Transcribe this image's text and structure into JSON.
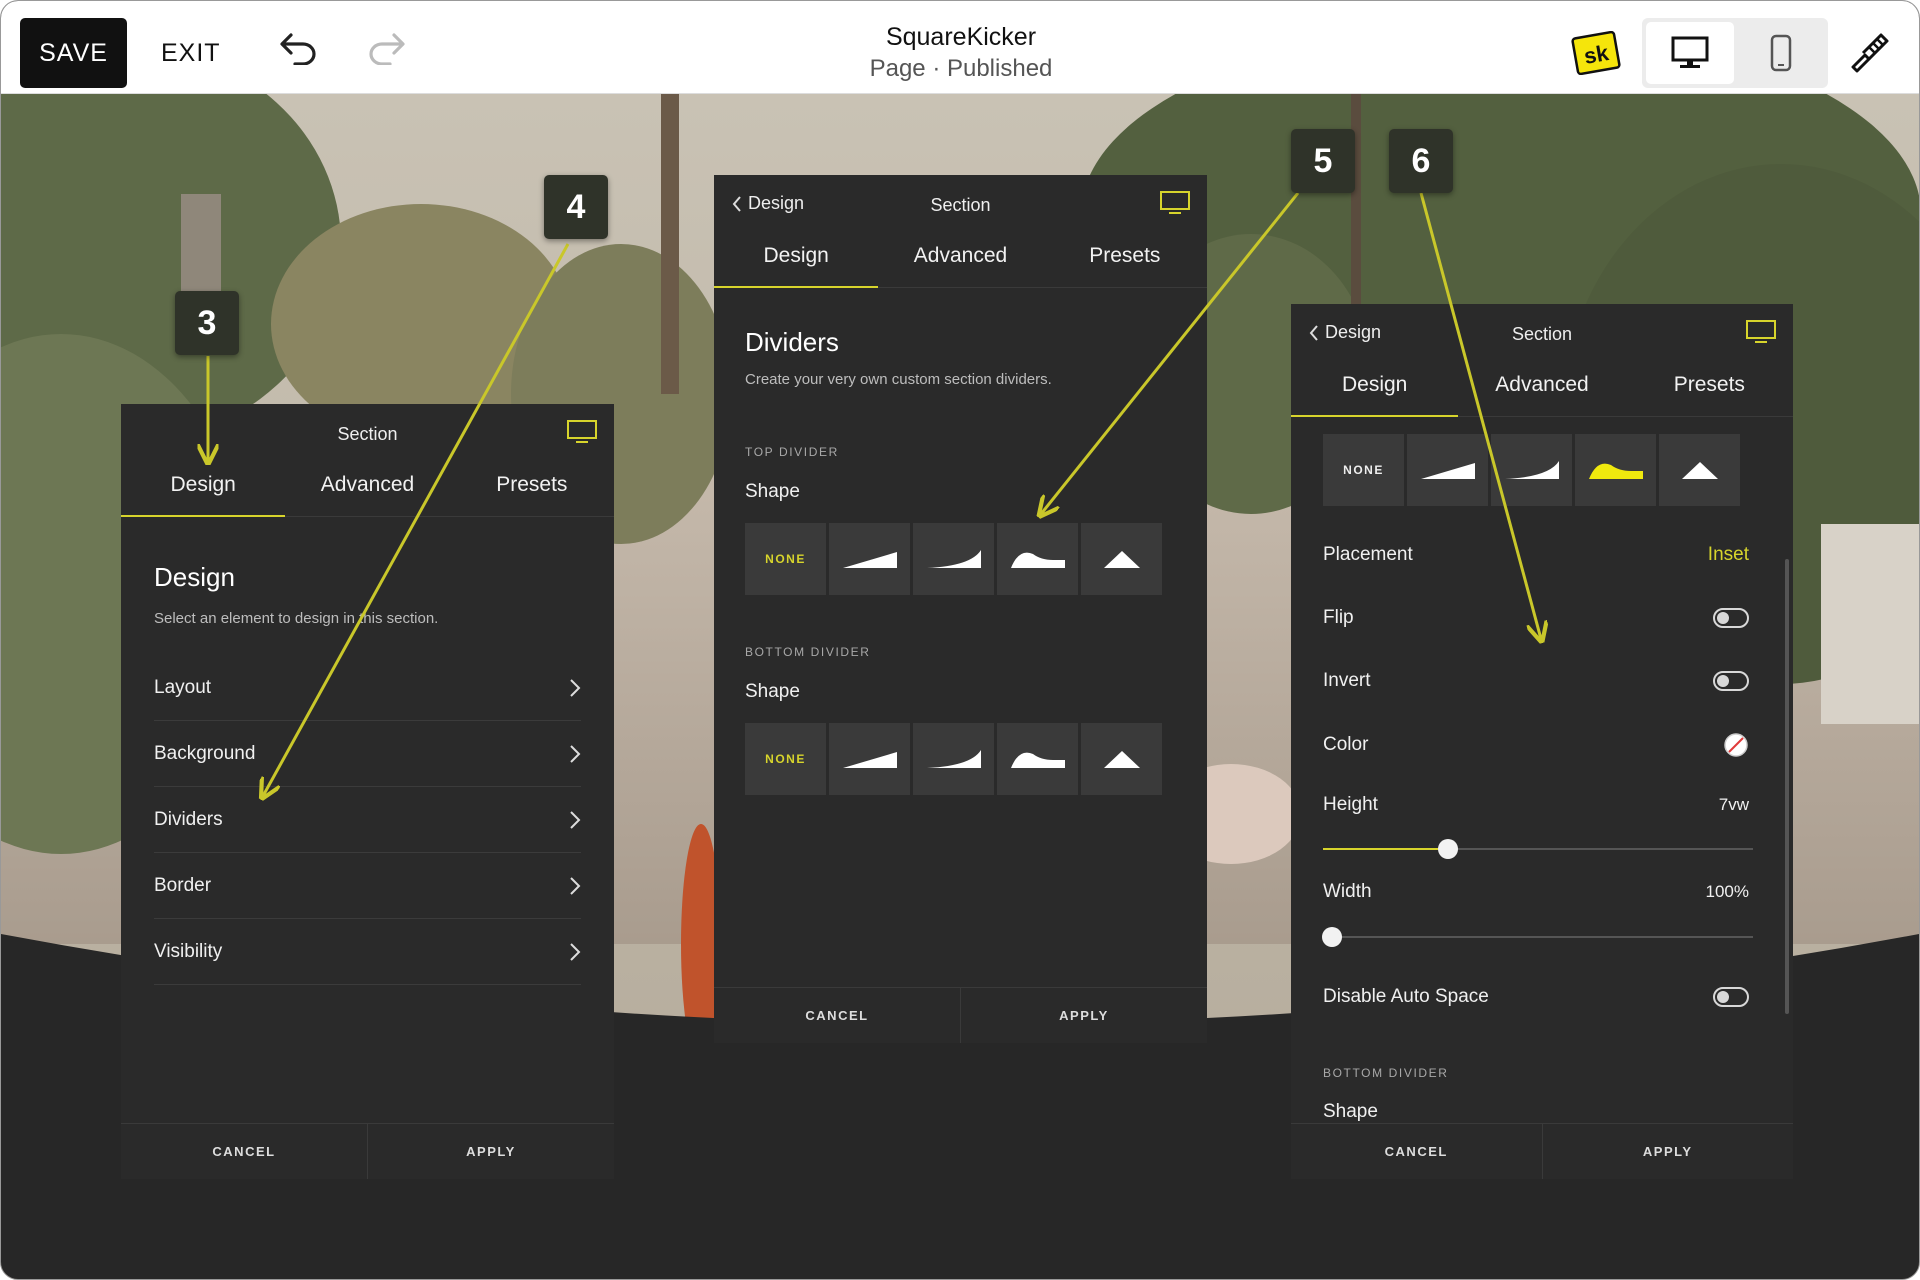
{
  "topbar": {
    "save_label": "SAVE",
    "exit_label": "EXIT",
    "app_title": "SquareKicker",
    "page_status": "Page · Published",
    "logo_text": "sk"
  },
  "colors": {
    "accent": "#d7d42c",
    "panel_bg": "#2a2a2a",
    "tile_bg": "#3a3a3a"
  },
  "callouts": [
    "3",
    "4",
    "5",
    "6"
  ],
  "panel1": {
    "header_section": "Section",
    "tabs": [
      "Design",
      "Advanced",
      "Presets"
    ],
    "active_tab": "Design",
    "title": "Design",
    "subtitle": "Select an element to design in this section.",
    "items": [
      "Layout",
      "Background",
      "Dividers",
      "Border",
      "Visibility"
    ],
    "footer": {
      "cancel": "CANCEL",
      "apply": "APPLY"
    }
  },
  "panel2": {
    "back_label": "Design",
    "header_section": "Section",
    "tabs": [
      "Design",
      "Advanced",
      "Presets"
    ],
    "title": "Dividers",
    "subtitle": "Create your very own custom section dividers.",
    "top_divider_label": "TOP DIVIDER",
    "top_shape_label": "Shape",
    "bottom_divider_label": "BOTTOM DIVIDER",
    "bottom_shape_label": "Shape",
    "none_label": "NONE",
    "shape_icons": [
      "none",
      "slope-icon",
      "curve-icon",
      "wave-icon",
      "triangle-icon"
    ],
    "footer": {
      "cancel": "CANCEL",
      "apply": "APPLY"
    }
  },
  "panel3": {
    "back_label": "Design",
    "header_section": "Section",
    "tabs": [
      "Design",
      "Advanced",
      "Presets"
    ],
    "none_label": "NONE",
    "selected_shape": "wave-icon",
    "placement_label": "Placement",
    "placement_value": "Inset",
    "flip_label": "Flip",
    "invert_label": "Invert",
    "color_label": "Color",
    "height_label": "Height",
    "height_value": "7vw",
    "height_fraction": 0.29,
    "width_label": "Width",
    "width_value": "100%",
    "width_fraction": 0.02,
    "disable_auto_space_label": "Disable Auto Space",
    "bottom_divider_label": "BOTTOM DIVIDER",
    "bottom_shape_label": "Shape",
    "footer": {
      "cancel": "CANCEL",
      "apply": "APPLY"
    }
  }
}
